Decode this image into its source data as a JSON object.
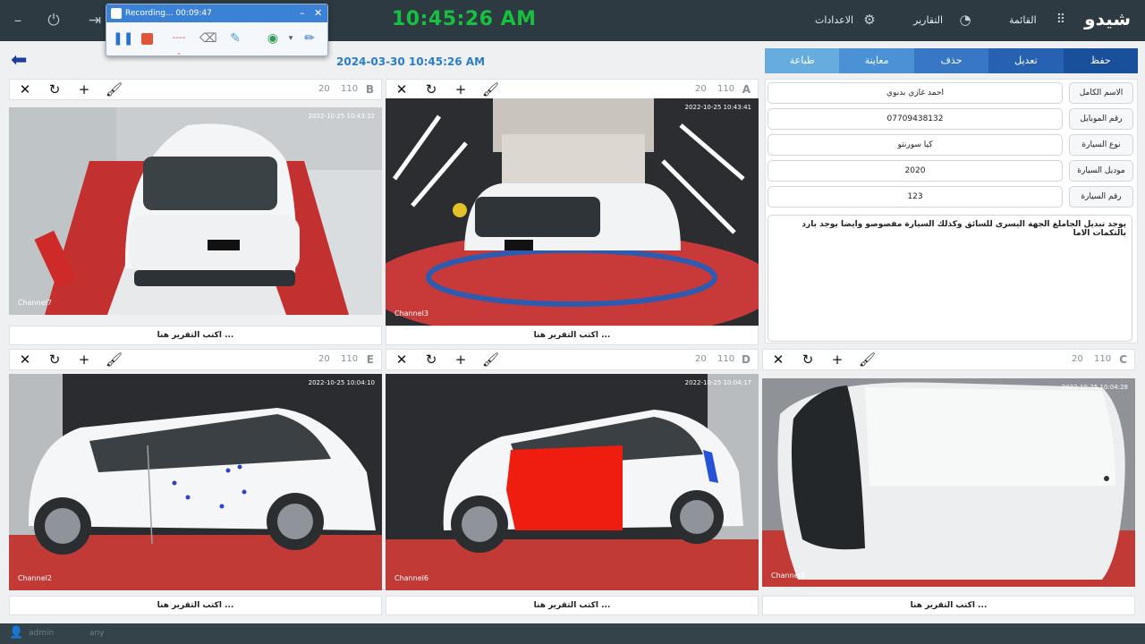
{
  "topbar": {
    "clock": "10:45:26 AM",
    "nav_menu": "القائمة",
    "nav_reports": "التقارير",
    "nav_settings": "الاعدادات",
    "logo": "شيدو"
  },
  "recorder": {
    "title": "Recording... 00:09:47"
  },
  "subbar": {
    "datetime": "2024-03-30 10:45:26 AM"
  },
  "tabs": [
    {
      "label": "حفظ",
      "color": "#1a4f9c"
    },
    {
      "label": "تعديل",
      "color": "#2761b2"
    },
    {
      "label": "حذف",
      "color": "#3777c4"
    },
    {
      "label": "معاينة",
      "color": "#4a91d6"
    },
    {
      "label": "طباعة",
      "color": "#66acde"
    }
  ],
  "form": {
    "full_name_label": "الاسم الكامل",
    "full_name_value": "احمد غازي بدبوي",
    "mobile_label": "رقم الموبايل",
    "mobile_value": "07709438132",
    "car_type_label": "نوع السيارة",
    "car_type_value": "كيا سورنتو",
    "car_model_label": "موديل السيارة",
    "car_model_value": "2020",
    "car_number_label": "رقم السيارة",
    "car_number_value": "123",
    "notes": "يوجد تبديل الجاملغ الجهة اليسرى للسائق وكذلك السيارة مقصوصو وايضا يوجد بارد بالتكمات الاما"
  },
  "panels": {
    "num_a": "20",
    "num_b": "110",
    "caption": "اكتب التقرير هنا ...",
    "B": {
      "letter": "B",
      "channel": "Channel7",
      "stamp": "2022-10-25 10:43:32"
    },
    "A": {
      "letter": "A",
      "channel": "Channel3",
      "stamp": "2022-10-25 10:43:41"
    },
    "E": {
      "letter": "E",
      "channel": "Channel2",
      "stamp": "2022-10-25 10:04:10"
    },
    "D": {
      "letter": "D",
      "channel": "Channel6",
      "stamp": "2022-10-25 10:04:17"
    },
    "C": {
      "letter": "C",
      "channel": "Channel8",
      "stamp": "2022-10-25 10:04:28"
    }
  },
  "footer": {
    "user": "admin",
    "role": "any"
  },
  "colors": {
    "clock": "#17c13f",
    "accent": "#2b7cc9",
    "topbar": "#2d3a42"
  }
}
